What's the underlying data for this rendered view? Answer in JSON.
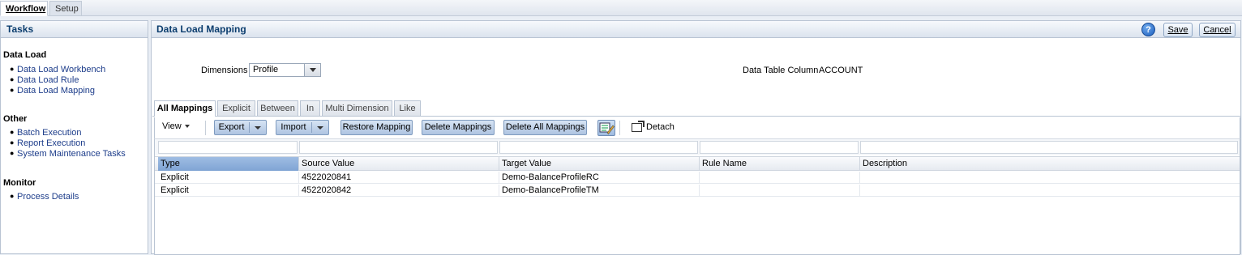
{
  "top_tabs": [
    {
      "label": "Workflow",
      "active": true
    },
    {
      "label": "Setup",
      "active": false
    }
  ],
  "tasks": {
    "title": "Tasks",
    "groups": [
      {
        "title": "Data Load",
        "links": [
          "Data Load Workbench",
          "Data Load Rule",
          "Data Load Mapping"
        ]
      },
      {
        "title": "Other",
        "links": [
          "Batch Execution",
          "Report Execution",
          "System Maintenance Tasks"
        ]
      },
      {
        "title": "Monitor",
        "links": [
          "Process Details"
        ]
      }
    ]
  },
  "main": {
    "title": "Data Load Mapping",
    "help_icon": "help-icon",
    "save_label": "Save",
    "cancel_label": "Cancel",
    "dimensions_label": "Dimensions",
    "dimensions_value": "Profile",
    "data_table_column_label": "Data Table Column",
    "data_table_column_value": "ACCOUNT",
    "sub_tabs": [
      "All Mappings",
      "Explicit",
      "Between",
      "In",
      "Multi Dimension",
      "Like"
    ],
    "active_sub_tab": "All Mappings",
    "toolbar": {
      "view_label": "View",
      "export_label": "Export",
      "import_label": "Import",
      "restore_label": "Restore Mapping",
      "delete_label": "Delete Mappings",
      "delete_all_label": "Delete All Mappings",
      "edit_icon": "edit-grid-icon",
      "detach_icon": "detach-icon",
      "detach_label": "Detach"
    },
    "grid": {
      "columns": [
        "Type",
        "Source Value",
        "Target Value",
        "Rule Name",
        "Description"
      ],
      "rows": [
        [
          "Explicit",
          "4522020841",
          "Demo-BalanceProfileRC",
          "",
          ""
        ],
        [
          "Explicit",
          "4522020842",
          "Demo-BalanceProfileTM",
          "",
          ""
        ]
      ]
    }
  },
  "colors": {
    "accent": "#0b3d6e",
    "link": "#1c3c8a",
    "button": "#aec4e1",
    "selected_header": "#7fa4d4"
  }
}
